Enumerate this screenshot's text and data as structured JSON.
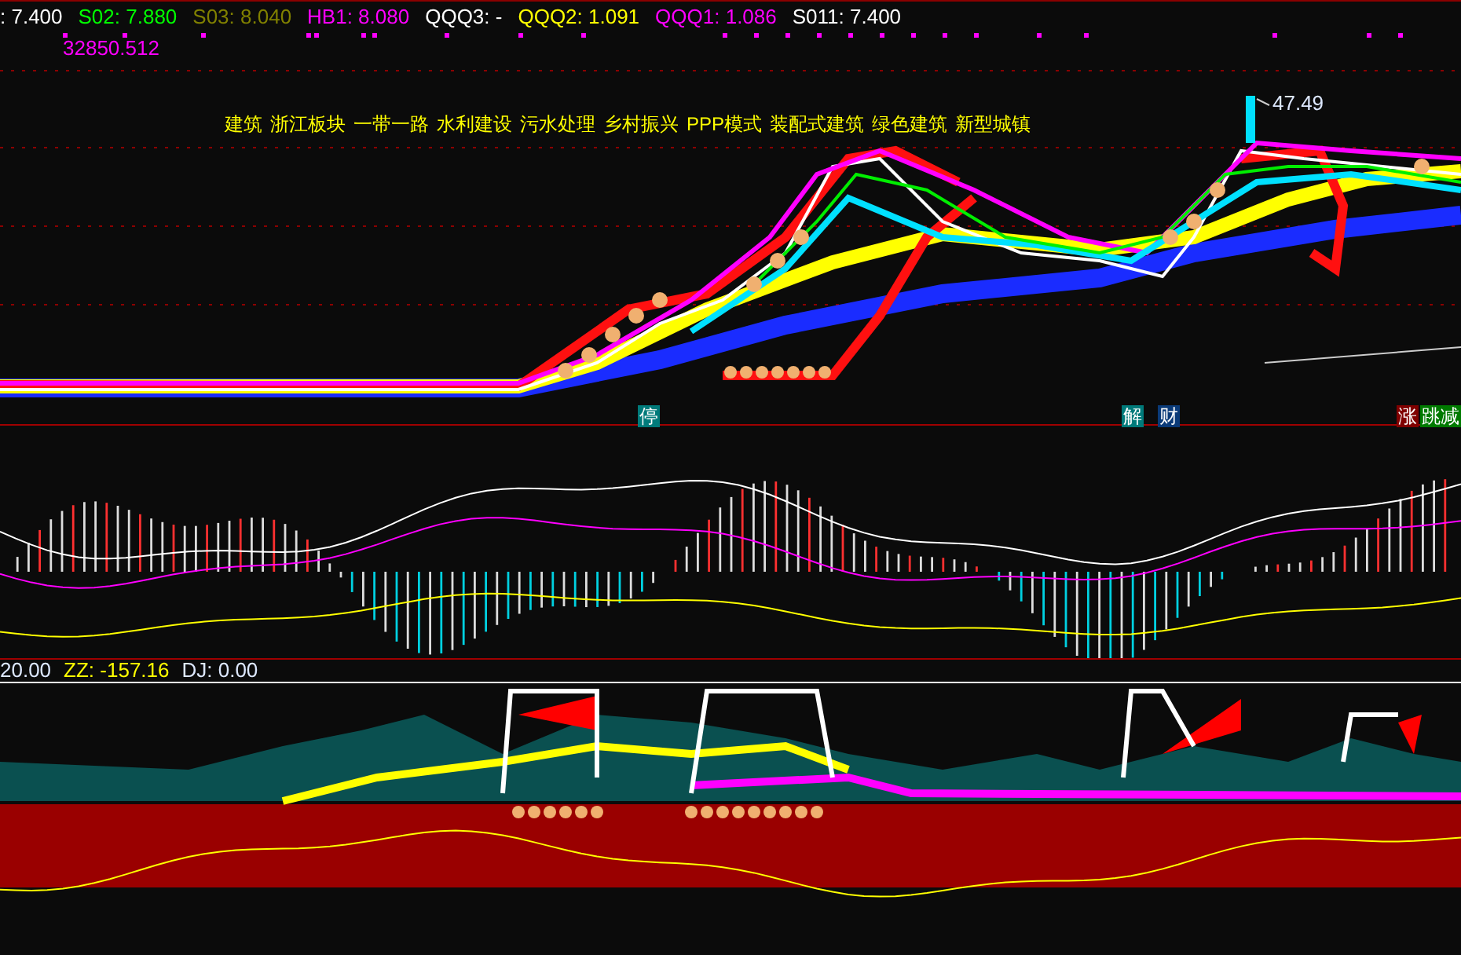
{
  "legend": [
    {
      "text": ": 7.400",
      "color": "#ffffff"
    },
    {
      "text": "S02: 7.880",
      "color": "#00ff00"
    },
    {
      "text": "S03: 8.040",
      "color": "#808000"
    },
    {
      "text": "HB1: 8.080",
      "color": "#ff00ff"
    },
    {
      "text": "QQQ3: -",
      "color": "#ffffff"
    },
    {
      "text": "QQQ2: 1.091",
      "color": "#ffff00"
    },
    {
      "text": "QQQ1: 1.086",
      "color": "#ff00ff"
    },
    {
      "text": "S011: 7.400",
      "color": "#ffffff"
    }
  ],
  "volume_value": "32850.512",
  "concepts": [
    "建筑",
    "浙江板块",
    "一带一路",
    "水利建设",
    "污水处理",
    "乡村振兴",
    "PPP模式",
    "装配式建筑",
    "绿色建筑",
    "新型城镇"
  ],
  "price_label": "47.49",
  "badges": [
    {
      "text": "停",
      "color": "#007a7a"
    },
    {
      "text": "解",
      "color": "#007a7a"
    },
    {
      "text": "财",
      "color": "#0a3a78"
    },
    {
      "text": "涨",
      "color": "#800000"
    },
    {
      "text": "跳减",
      "color": "#007a00"
    }
  ],
  "bottom_legend": [
    {
      "text": "20.00",
      "color": "#dde8ff"
    },
    {
      "text": "ZZ: -157.16",
      "color": "#ffff00"
    },
    {
      "text": "DJ: 0.00",
      "color": "#dde8ff"
    }
  ]
}
